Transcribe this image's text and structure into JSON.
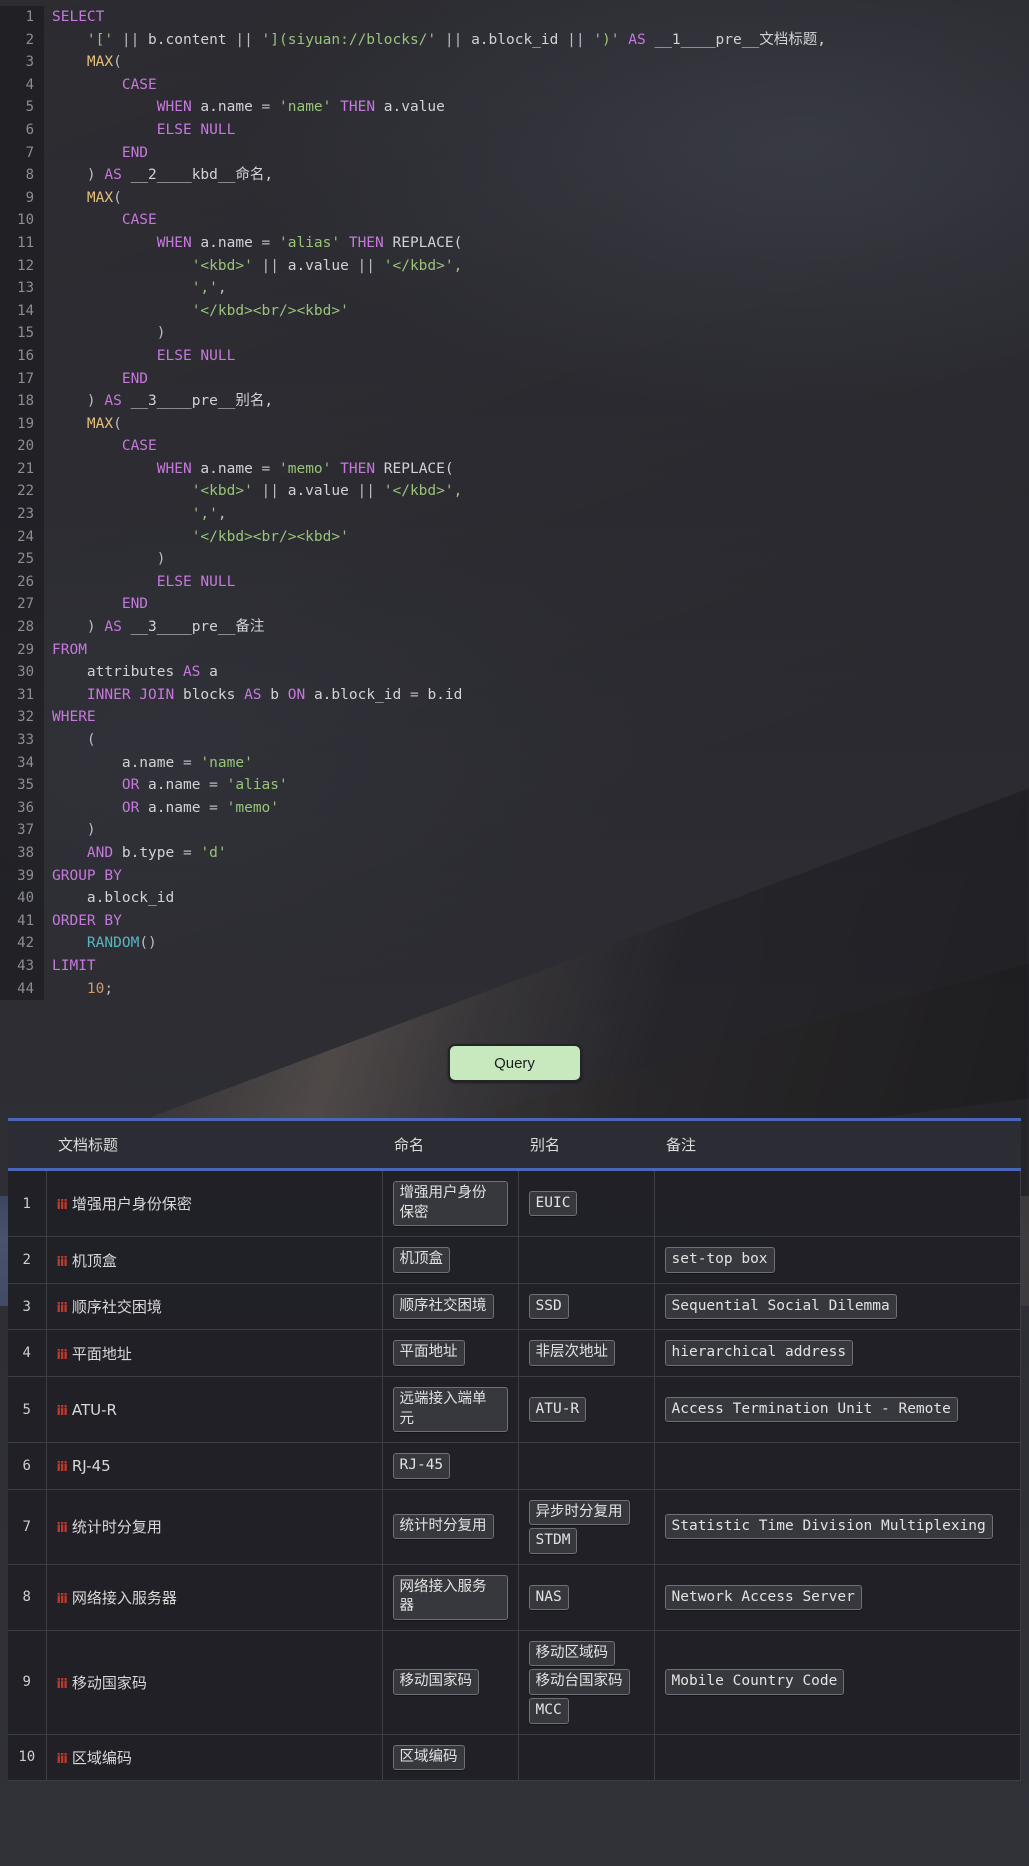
{
  "editor": {
    "language": "sql",
    "lines": [
      {
        "n": 1,
        "tokens": [
          {
            "t": "SELECT",
            "c": "kw"
          }
        ]
      },
      {
        "n": 2,
        "tokens": [
          {
            "t": "    ",
            "c": "plain"
          },
          {
            "t": "'['",
            "c": "str"
          },
          {
            "t": " || ",
            "c": "op"
          },
          {
            "t": "b.content",
            "c": "ident"
          },
          {
            "t": " || ",
            "c": "op"
          },
          {
            "t": "'](siyuan://blocks/'",
            "c": "str"
          },
          {
            "t": " || ",
            "c": "op"
          },
          {
            "t": "a.block_id",
            "c": "ident"
          },
          {
            "t": " || ",
            "c": "op"
          },
          {
            "t": "')'",
            "c": "str"
          },
          {
            "t": " ",
            "c": "plain"
          },
          {
            "t": "AS",
            "c": "kw"
          },
          {
            "t": " __1____pre__文档标题,",
            "c": "plain"
          }
        ]
      },
      {
        "n": 3,
        "tokens": [
          {
            "t": "    ",
            "c": "plain"
          },
          {
            "t": "MAX",
            "c": "fn"
          },
          {
            "t": "(",
            "c": "op"
          }
        ]
      },
      {
        "n": 4,
        "tokens": [
          {
            "t": "        ",
            "c": "plain"
          },
          {
            "t": "CASE",
            "c": "kw"
          }
        ]
      },
      {
        "n": 5,
        "tokens": [
          {
            "t": "            ",
            "c": "plain"
          },
          {
            "t": "WHEN",
            "c": "kw"
          },
          {
            "t": " a.name ",
            "c": "ident"
          },
          {
            "t": "=",
            "c": "op"
          },
          {
            "t": " ",
            "c": "plain"
          },
          {
            "t": "'name'",
            "c": "str"
          },
          {
            "t": " ",
            "c": "plain"
          },
          {
            "t": "THEN",
            "c": "kw"
          },
          {
            "t": " a.value",
            "c": "ident"
          }
        ]
      },
      {
        "n": 6,
        "tokens": [
          {
            "t": "            ",
            "c": "plain"
          },
          {
            "t": "ELSE NULL",
            "c": "kw"
          }
        ]
      },
      {
        "n": 7,
        "tokens": [
          {
            "t": "        ",
            "c": "plain"
          },
          {
            "t": "END",
            "c": "kw"
          }
        ]
      },
      {
        "n": 8,
        "tokens": [
          {
            "t": "    ",
            "c": "plain"
          },
          {
            "t": ")",
            "c": "op"
          },
          {
            "t": " ",
            "c": "plain"
          },
          {
            "t": "AS",
            "c": "kw"
          },
          {
            "t": " __2____kbd__命名,",
            "c": "plain"
          }
        ]
      },
      {
        "n": 9,
        "tokens": [
          {
            "t": "    ",
            "c": "plain"
          },
          {
            "t": "MAX",
            "c": "fn"
          },
          {
            "t": "(",
            "c": "op"
          }
        ]
      },
      {
        "n": 10,
        "tokens": [
          {
            "t": "        ",
            "c": "plain"
          },
          {
            "t": "CASE",
            "c": "kw"
          }
        ]
      },
      {
        "n": 11,
        "tokens": [
          {
            "t": "            ",
            "c": "plain"
          },
          {
            "t": "WHEN",
            "c": "kw"
          },
          {
            "t": " a.name ",
            "c": "ident"
          },
          {
            "t": "=",
            "c": "op"
          },
          {
            "t": " ",
            "c": "plain"
          },
          {
            "t": "'alias'",
            "c": "str"
          },
          {
            "t": " ",
            "c": "plain"
          },
          {
            "t": "THEN",
            "c": "kw"
          },
          {
            "t": " REPLACE(",
            "c": "ident"
          }
        ]
      },
      {
        "n": 12,
        "tokens": [
          {
            "t": "                ",
            "c": "plain"
          },
          {
            "t": "'<kbd>'",
            "c": "str"
          },
          {
            "t": " || ",
            "c": "op"
          },
          {
            "t": "a.value",
            "c": "ident"
          },
          {
            "t": " || ",
            "c": "op"
          },
          {
            "t": "'</kbd>',",
            "c": "str"
          }
        ]
      },
      {
        "n": 13,
        "tokens": [
          {
            "t": "                ",
            "c": "plain"
          },
          {
            "t": "','",
            "c": "str"
          },
          {
            "t": ",",
            "c": "op"
          }
        ]
      },
      {
        "n": 14,
        "tokens": [
          {
            "t": "                ",
            "c": "plain"
          },
          {
            "t": "'</kbd><br/><kbd>'",
            "c": "str"
          }
        ]
      },
      {
        "n": 15,
        "tokens": [
          {
            "t": "            ",
            "c": "plain"
          },
          {
            "t": ")",
            "c": "op"
          }
        ]
      },
      {
        "n": 16,
        "tokens": [
          {
            "t": "            ",
            "c": "plain"
          },
          {
            "t": "ELSE NULL",
            "c": "kw"
          }
        ]
      },
      {
        "n": 17,
        "tokens": [
          {
            "t": "        ",
            "c": "plain"
          },
          {
            "t": "END",
            "c": "kw"
          }
        ]
      },
      {
        "n": 18,
        "tokens": [
          {
            "t": "    ",
            "c": "plain"
          },
          {
            "t": ")",
            "c": "op"
          },
          {
            "t": " ",
            "c": "plain"
          },
          {
            "t": "AS",
            "c": "kw"
          },
          {
            "t": " __3____pre__别名,",
            "c": "plain"
          }
        ]
      },
      {
        "n": 19,
        "tokens": [
          {
            "t": "    ",
            "c": "plain"
          },
          {
            "t": "MAX",
            "c": "fn"
          },
          {
            "t": "(",
            "c": "op"
          }
        ]
      },
      {
        "n": 20,
        "tokens": [
          {
            "t": "        ",
            "c": "plain"
          },
          {
            "t": "CASE",
            "c": "kw"
          }
        ]
      },
      {
        "n": 21,
        "tokens": [
          {
            "t": "            ",
            "c": "plain"
          },
          {
            "t": "WHEN",
            "c": "kw"
          },
          {
            "t": " a.name ",
            "c": "ident"
          },
          {
            "t": "=",
            "c": "op"
          },
          {
            "t": " ",
            "c": "plain"
          },
          {
            "t": "'memo'",
            "c": "str"
          },
          {
            "t": " ",
            "c": "plain"
          },
          {
            "t": "THEN",
            "c": "kw"
          },
          {
            "t": " REPLACE(",
            "c": "ident"
          }
        ]
      },
      {
        "n": 22,
        "tokens": [
          {
            "t": "                ",
            "c": "plain"
          },
          {
            "t": "'<kbd>'",
            "c": "str"
          },
          {
            "t": " || ",
            "c": "op"
          },
          {
            "t": "a.value",
            "c": "ident"
          },
          {
            "t": " || ",
            "c": "op"
          },
          {
            "t": "'</kbd>',",
            "c": "str"
          }
        ]
      },
      {
        "n": 23,
        "tokens": [
          {
            "t": "                ",
            "c": "plain"
          },
          {
            "t": "','",
            "c": "str"
          },
          {
            "t": ",",
            "c": "op"
          }
        ]
      },
      {
        "n": 24,
        "tokens": [
          {
            "t": "                ",
            "c": "plain"
          },
          {
            "t": "'</kbd><br/><kbd>'",
            "c": "str"
          }
        ]
      },
      {
        "n": 25,
        "tokens": [
          {
            "t": "            ",
            "c": "plain"
          },
          {
            "t": ")",
            "c": "op"
          }
        ]
      },
      {
        "n": 26,
        "tokens": [
          {
            "t": "            ",
            "c": "plain"
          },
          {
            "t": "ELSE NULL",
            "c": "kw"
          }
        ]
      },
      {
        "n": 27,
        "tokens": [
          {
            "t": "        ",
            "c": "plain"
          },
          {
            "t": "END",
            "c": "kw"
          }
        ]
      },
      {
        "n": 28,
        "tokens": [
          {
            "t": "    ",
            "c": "plain"
          },
          {
            "t": ")",
            "c": "op"
          },
          {
            "t": " ",
            "c": "plain"
          },
          {
            "t": "AS",
            "c": "kw"
          },
          {
            "t": " __3____pre__备注",
            "c": "plain"
          }
        ]
      },
      {
        "n": 29,
        "tokens": [
          {
            "t": "FROM",
            "c": "kw"
          }
        ]
      },
      {
        "n": 30,
        "tokens": [
          {
            "t": "    attributes ",
            "c": "ident"
          },
          {
            "t": "AS",
            "c": "kw"
          },
          {
            "t": " a",
            "c": "ident"
          }
        ]
      },
      {
        "n": 31,
        "tokens": [
          {
            "t": "    ",
            "c": "plain"
          },
          {
            "t": "INNER JOIN",
            "c": "kw"
          },
          {
            "t": " blocks ",
            "c": "ident"
          },
          {
            "t": "AS",
            "c": "kw"
          },
          {
            "t": " b ",
            "c": "ident"
          },
          {
            "t": "ON",
            "c": "kw"
          },
          {
            "t": " a.block_id ",
            "c": "ident"
          },
          {
            "t": "=",
            "c": "op"
          },
          {
            "t": " b.id",
            "c": "ident"
          }
        ]
      },
      {
        "n": 32,
        "tokens": [
          {
            "t": "WHERE",
            "c": "kw"
          }
        ]
      },
      {
        "n": 33,
        "tokens": [
          {
            "t": "    ",
            "c": "plain"
          },
          {
            "t": "(",
            "c": "op"
          }
        ]
      },
      {
        "n": 34,
        "tokens": [
          {
            "t": "        a.name ",
            "c": "ident"
          },
          {
            "t": "=",
            "c": "op"
          },
          {
            "t": " ",
            "c": "plain"
          },
          {
            "t": "'name'",
            "c": "str"
          }
        ]
      },
      {
        "n": 35,
        "tokens": [
          {
            "t": "        ",
            "c": "plain"
          },
          {
            "t": "OR",
            "c": "kw"
          },
          {
            "t": " a.name ",
            "c": "ident"
          },
          {
            "t": "=",
            "c": "op"
          },
          {
            "t": " ",
            "c": "plain"
          },
          {
            "t": "'alias'",
            "c": "str"
          }
        ]
      },
      {
        "n": 36,
        "tokens": [
          {
            "t": "        ",
            "c": "plain"
          },
          {
            "t": "OR",
            "c": "kw"
          },
          {
            "t": " a.name ",
            "c": "ident"
          },
          {
            "t": "=",
            "c": "op"
          },
          {
            "t": " ",
            "c": "plain"
          },
          {
            "t": "'memo'",
            "c": "str"
          }
        ]
      },
      {
        "n": 37,
        "tokens": [
          {
            "t": "    ",
            "c": "plain"
          },
          {
            "t": ")",
            "c": "op"
          }
        ]
      },
      {
        "n": 38,
        "tokens": [
          {
            "t": "    ",
            "c": "plain"
          },
          {
            "t": "AND",
            "c": "kw"
          },
          {
            "t": " b.type ",
            "c": "ident"
          },
          {
            "t": "=",
            "c": "op"
          },
          {
            "t": " ",
            "c": "plain"
          },
          {
            "t": "'d'",
            "c": "str"
          }
        ]
      },
      {
        "n": 39,
        "tokens": [
          {
            "t": "GROUP BY",
            "c": "kw"
          }
        ]
      },
      {
        "n": 40,
        "tokens": [
          {
            "t": "    a.block_id",
            "c": "ident"
          }
        ]
      },
      {
        "n": 41,
        "tokens": [
          {
            "t": "ORDER BY",
            "c": "kw"
          }
        ]
      },
      {
        "n": 42,
        "tokens": [
          {
            "t": "    ",
            "c": "plain"
          },
          {
            "t": "RANDOM",
            "c": "cyan"
          },
          {
            "t": "()",
            "c": "op"
          }
        ]
      },
      {
        "n": 43,
        "tokens": [
          {
            "t": "LIMIT",
            "c": "kw"
          }
        ]
      },
      {
        "n": 44,
        "tokens": [
          {
            "t": "    ",
            "c": "plain"
          },
          {
            "t": "10",
            "c": "num"
          },
          {
            "t": ";",
            "c": "op"
          }
        ]
      }
    ]
  },
  "toolbar": {
    "query_label": "Query",
    "button_color": "#c7e9bd",
    "accent_color": "#4a66b8"
  },
  "results": {
    "columns": [
      "",
      "文档标题",
      "命名",
      "别名",
      "备注"
    ],
    "rows": [
      {
        "idx": "1",
        "title": "增强用户身份保密",
        "names": [
          "增强用户身份保密"
        ],
        "aliases": [
          "EUIC"
        ],
        "memos": []
      },
      {
        "idx": "2",
        "title": "机顶盒",
        "names": [
          "机顶盒"
        ],
        "aliases": [],
        "memos": [
          "set-top box"
        ]
      },
      {
        "idx": "3",
        "title": "顺序社交困境",
        "names": [
          "顺序社交困境"
        ],
        "aliases": [
          "SSD"
        ],
        "memos": [
          "Sequential Social Dilemma"
        ]
      },
      {
        "idx": "4",
        "title": "平面地址",
        "names": [
          "平面地址"
        ],
        "aliases": [
          "非层次地址"
        ],
        "memos": [
          "hierarchical address"
        ]
      },
      {
        "idx": "5",
        "title": "ATU-R",
        "names": [
          "远端接入端单元"
        ],
        "aliases": [
          "ATU-R"
        ],
        "memos": [
          "Access Termination Unit - Remote"
        ]
      },
      {
        "idx": "6",
        "title": "RJ-45",
        "names": [
          "RJ-45"
        ],
        "aliases": [],
        "memos": []
      },
      {
        "idx": "7",
        "title": "统计时分复用",
        "names": [
          "统计时分复用"
        ],
        "aliases": [
          "异步时分复用",
          "STDM"
        ],
        "memos": [
          "Statistic Time Division Multiplexing"
        ]
      },
      {
        "idx": "8",
        "title": "网络接入服务器",
        "names": [
          "网络接入服务器"
        ],
        "aliases": [
          "NAS"
        ],
        "memos": [
          "Network Access Server"
        ]
      },
      {
        "idx": "9",
        "title": "移动国家码",
        "names": [
          "移动国家码"
        ],
        "aliases": [
          "移动区域码",
          "移动台国家码",
          "MCC"
        ],
        "memos": [
          "Mobile Country Code"
        ]
      },
      {
        "idx": "10",
        "title": "区域编码",
        "names": [
          "区域编码"
        ],
        "aliases": [],
        "memos": []
      }
    ],
    "row_icon": "reference-link-icon"
  }
}
